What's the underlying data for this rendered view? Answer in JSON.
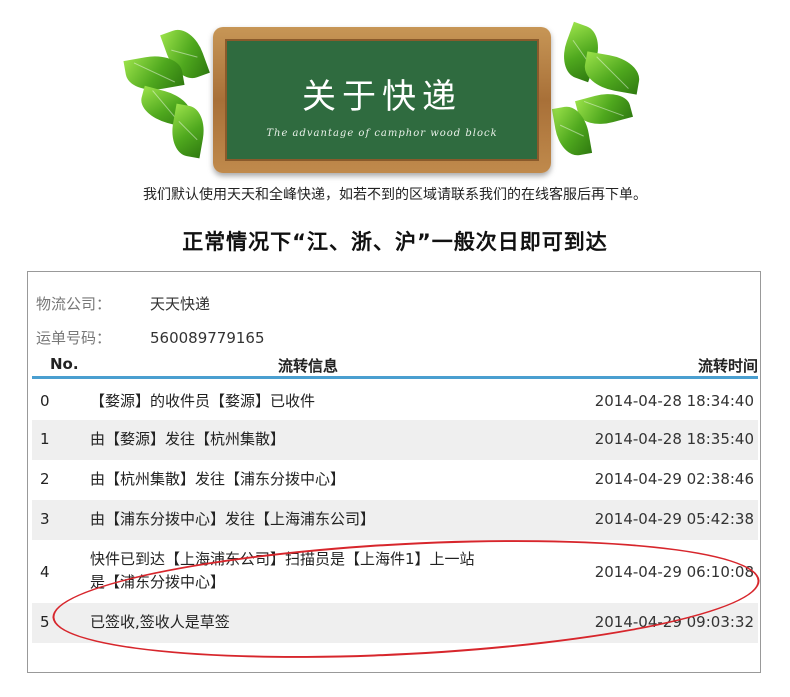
{
  "header": {
    "board_title": "关于快递",
    "board_subtitle": "The advantage of camphor wood block",
    "notice": "我们默认使用天天和全峰快递，如若不到的区域请联系我们的在线客服后再下单。",
    "headline": "正常情况下“江、浙、沪”一般次日即可到达"
  },
  "tracking": {
    "company_label": "物流公司：",
    "company_value": "天天快递",
    "waybill_label": "运单号码：",
    "waybill_value": "560089779165",
    "columns": [
      "No.",
      "流转信息",
      "流转时间"
    ],
    "rows": [
      {
        "no": "0",
        "info": "【婺源】的收件员【婺源】已收件",
        "time": "2014-04-28 18:34:40"
      },
      {
        "no": "1",
        "info": "由【婺源】发往【杭州集散】",
        "time": "2014-04-28 18:35:40"
      },
      {
        "no": "2",
        "info": "由【杭州集散】发往【浦东分拨中心】",
        "time": "2014-04-29 02:38:46"
      },
      {
        "no": "3",
        "info": "由【浦东分拨中心】发往【上海浦东公司】",
        "time": "2014-04-29 05:42:38"
      },
      {
        "no": "4",
        "info_line1": "快件已到达【上海浦东公司】扫描员是【上海件1】上一站",
        "info_line2": "是【浦东分拨中心】",
        "time": "2014-04-29 06:10:08"
      },
      {
        "no": "5",
        "info": "已签收,签收人是草签",
        "time": "2014-04-29 09:03:32"
      }
    ]
  },
  "colors": {
    "board_green": "#2f6b3f",
    "wood": "#a87038",
    "accent_blue": "#4a9fd0",
    "annotation_red": "#d7262c"
  },
  "icons": [
    "leaf-icon"
  ]
}
